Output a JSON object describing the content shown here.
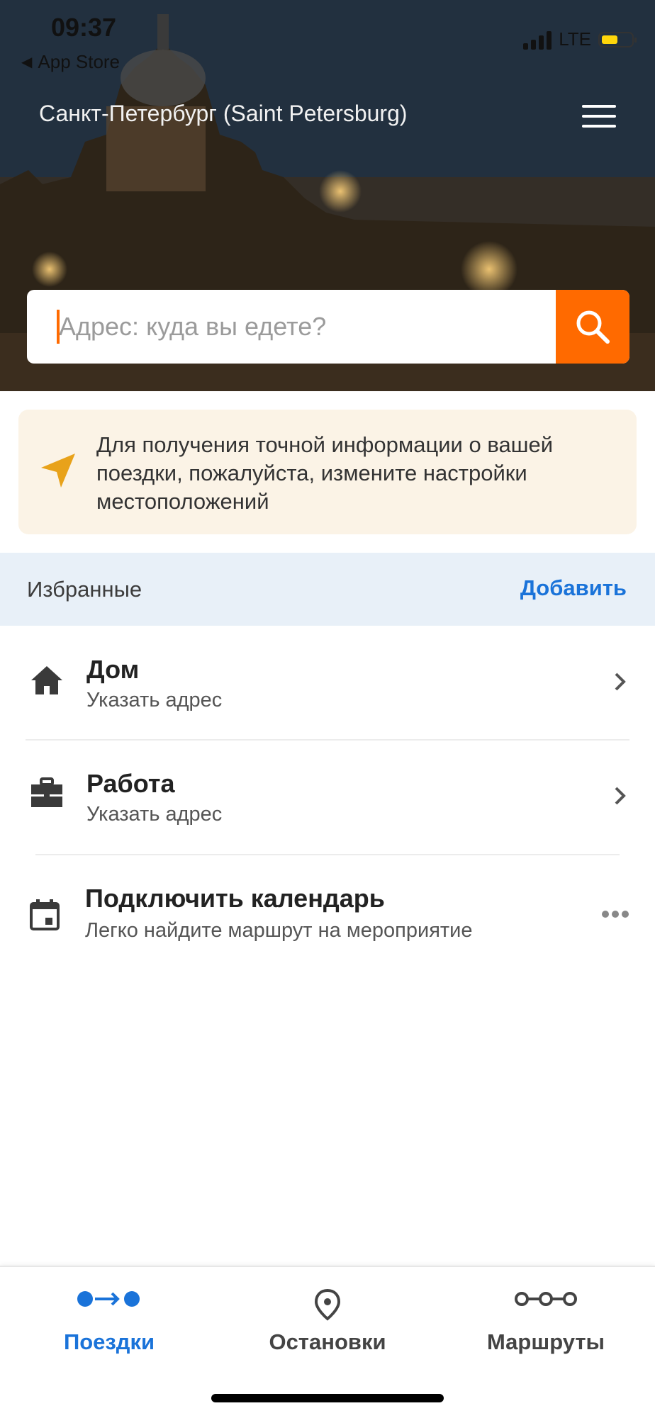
{
  "status_bar": {
    "time": "09:37",
    "back_app": "App Store",
    "network": "LTE",
    "battery_color": "#ffd60a"
  },
  "header": {
    "city": "Санкт-Петербург (Saint Petersburg)",
    "menu_icon": "hamburger-icon"
  },
  "search": {
    "placeholder": "Адрес: куда вы едете?",
    "value": "",
    "button_icon": "search-icon"
  },
  "location_notice": {
    "icon": "location-arrow-icon",
    "text": "Для получения точной информации о вашей поездки, пожалуйста, измените настройки местоположений"
  },
  "favorites": {
    "title": "Избранные",
    "add_label": "Добавить",
    "items": [
      {
        "icon": "home-icon",
        "title": "Дом",
        "subtitle": "Указать адрес",
        "action_icon": "chevron-right-icon"
      },
      {
        "icon": "briefcase-icon",
        "title": "Работа",
        "subtitle": "Указать адрес",
        "action_icon": "chevron-right-icon"
      },
      {
        "icon": "calendar-icon",
        "title": "Подключить календарь",
        "subtitle": "Легко найдите маршрут на мероприятие",
        "action_icon": "more-dots-icon"
      }
    ]
  },
  "tabbar": {
    "tabs": [
      {
        "label": "Поездки",
        "icon": "trip-icon",
        "active": true
      },
      {
        "label": "Остановки",
        "icon": "stop-pin-icon",
        "active": false
      },
      {
        "label": "Маршруты",
        "icon": "routes-icon",
        "active": false
      }
    ]
  },
  "colors": {
    "accent_orange": "#ff6a00",
    "link_blue": "#1a73d9",
    "notice_bg": "#fbf3e6",
    "favorites_header_bg": "#e8f0f8",
    "notice_icon": "#e8a21a",
    "inactive_tab": "#444444"
  }
}
